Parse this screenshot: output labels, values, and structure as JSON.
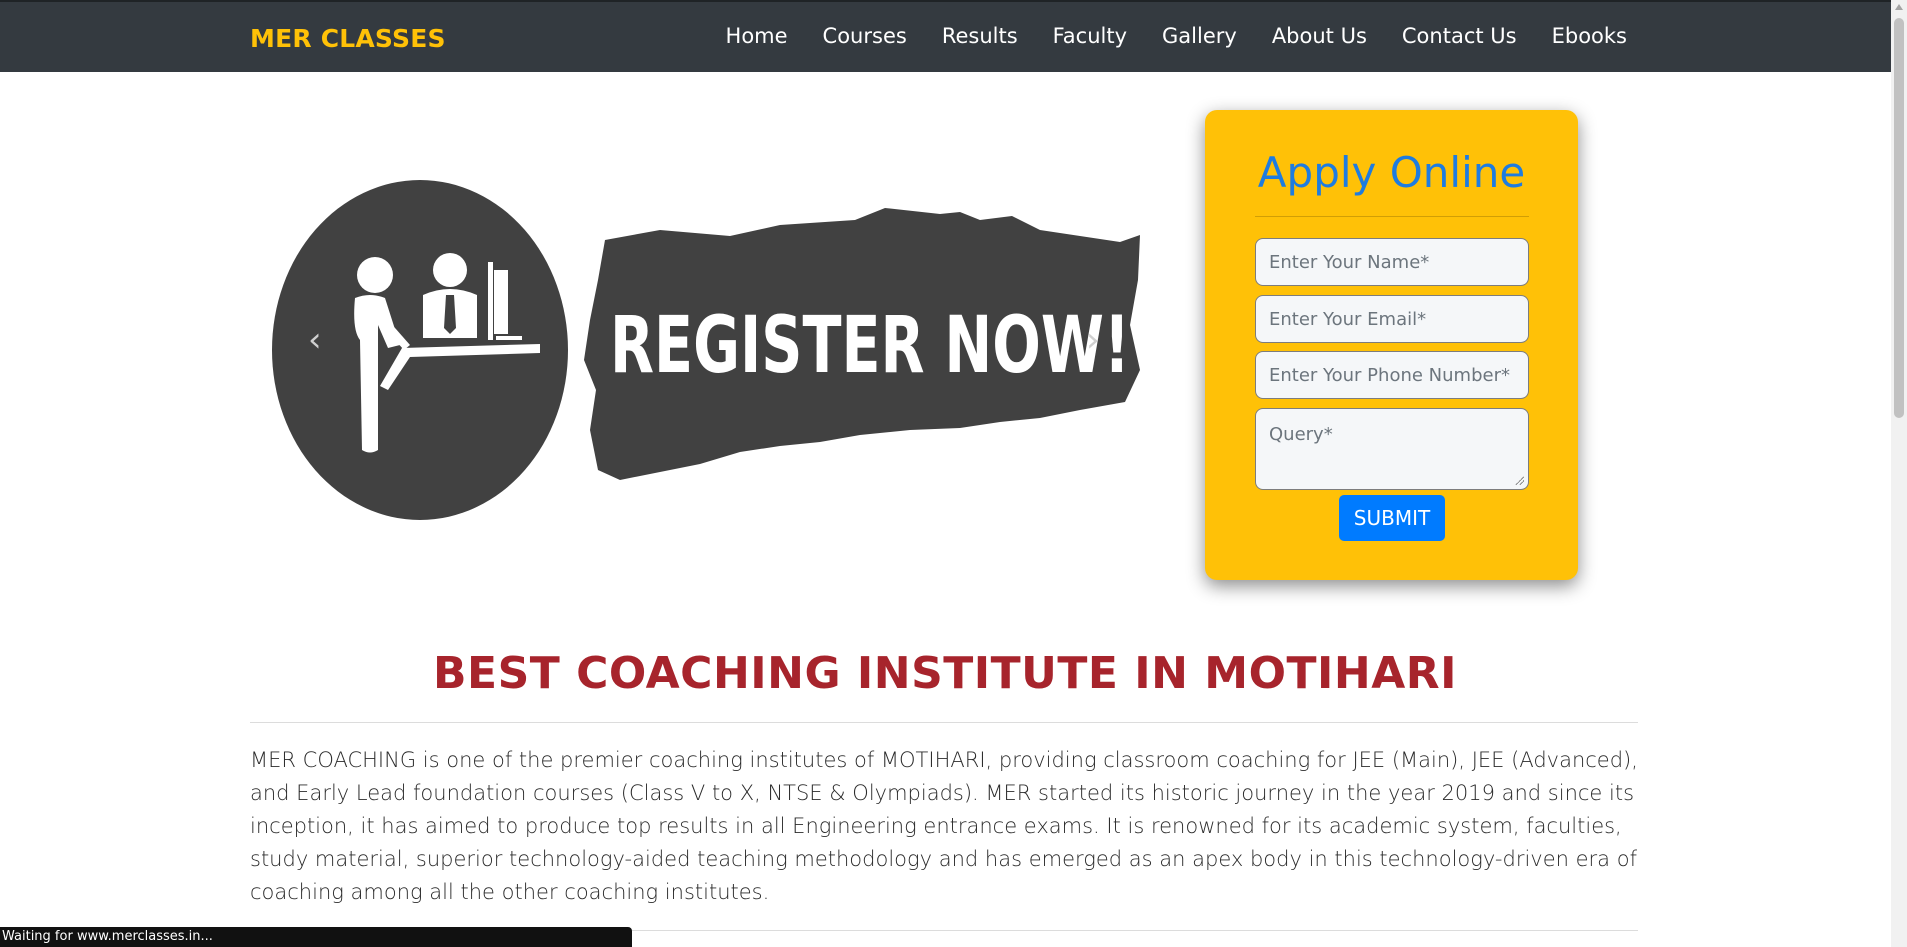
{
  "navbar": {
    "brand": "MER CLASSES",
    "items": [
      "Home",
      "Courses",
      "Results",
      "Faculty",
      "Gallery",
      "About Us",
      "Contact Us",
      "Ebooks"
    ]
  },
  "hero": {
    "banner_text": "REGISTER NOW!",
    "prev_glyph": "‹",
    "next_glyph": "›"
  },
  "apply_form": {
    "title": "Apply Online",
    "name_placeholder": "Enter Your Name*",
    "email_placeholder": "Enter Your Email*",
    "phone_placeholder": "Enter Your Phone Number*",
    "query_placeholder": "Query*",
    "submit_label": "SUBMIT"
  },
  "intro": {
    "heading": "BEST COACHING INSTITUTE IN MOTIHARI",
    "body": "MER COACHING is one of the premier coaching institutes of MOTIHARI, providing classroom coaching for JEE (Main), JEE (Advanced), and Early Lead foundation courses (Class V to X, NTSE & Olympiads). MER started its historic journey in the year 2019 and since its inception, it has aimed to produce top results in all Engineering entrance exams. It is renowned for its academic system, faculties, study material, superior technology-aided teaching methodology and has emerged as an apex body in this technology-driven era of coaching among all the other coaching institutes."
  },
  "status": {
    "text": "Waiting for www.merclasses.in..."
  },
  "colors": {
    "navbar": "#343a40",
    "brand": "#ffc107",
    "card": "#ffc107",
    "title": "#1e7ce0",
    "button": "#007bff",
    "heading": "#a7242c",
    "banner": "#414141"
  }
}
